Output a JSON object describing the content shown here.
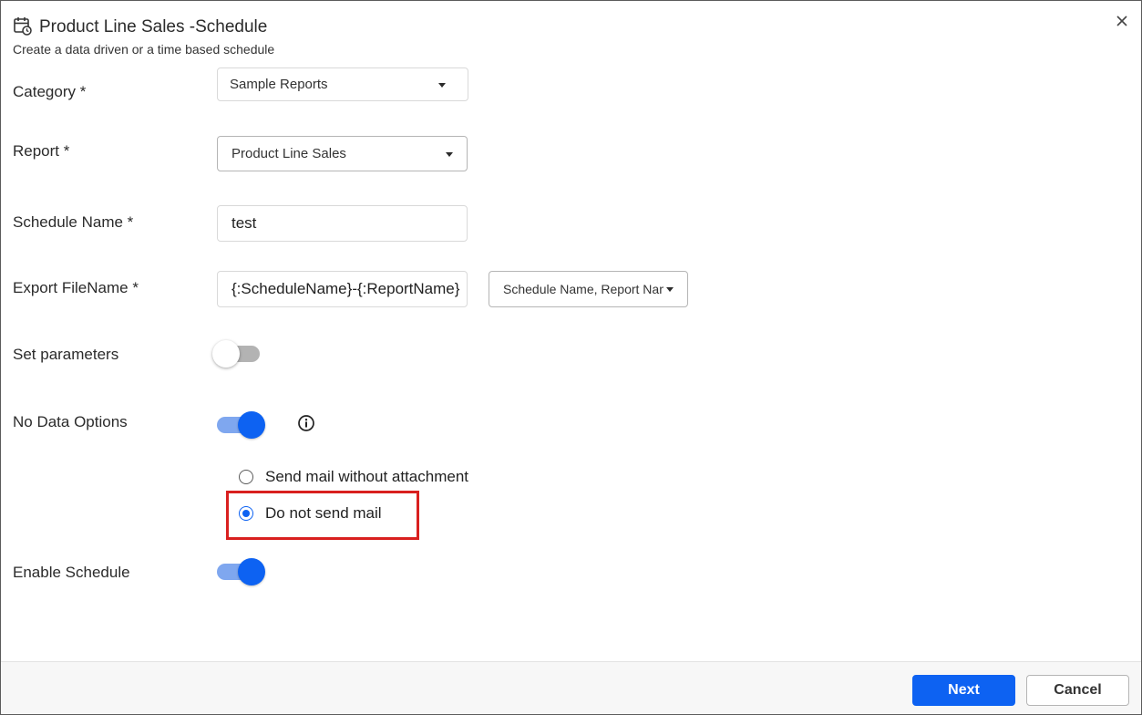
{
  "header": {
    "icon": "calendar-clock-icon",
    "title": "Product Line Sales -Schedule",
    "subtitle": "Create a data driven or a time based schedule",
    "close_icon": "close-icon"
  },
  "form": {
    "category": {
      "label": "Category *",
      "value": "Sample Reports"
    },
    "report": {
      "label": "Report *",
      "value": "Product Line Sales"
    },
    "schedule_name": {
      "label": "Schedule Name *",
      "value": "test"
    },
    "export_filename": {
      "label": "Export FileName *",
      "value": "{:ScheduleName}-{:ReportName}",
      "dropdown_value": "Schedule Name, Report Name"
    },
    "set_parameters": {
      "label": "Set parameters",
      "enabled": false
    },
    "no_data_options": {
      "label": "No Data Options",
      "enabled": true,
      "info_icon": "info-icon",
      "options": [
        {
          "label": "Send mail without attachment",
          "checked": false
        },
        {
          "label": "Do not send mail",
          "checked": true
        }
      ]
    },
    "enable_schedule": {
      "label": "Enable Schedule",
      "enabled": true
    }
  },
  "footer": {
    "next_label": "Next",
    "cancel_label": "Cancel"
  },
  "colors": {
    "primary": "#0d62f2",
    "toggle_track_on": "#7fa7ef",
    "highlight": "#d9201f"
  }
}
